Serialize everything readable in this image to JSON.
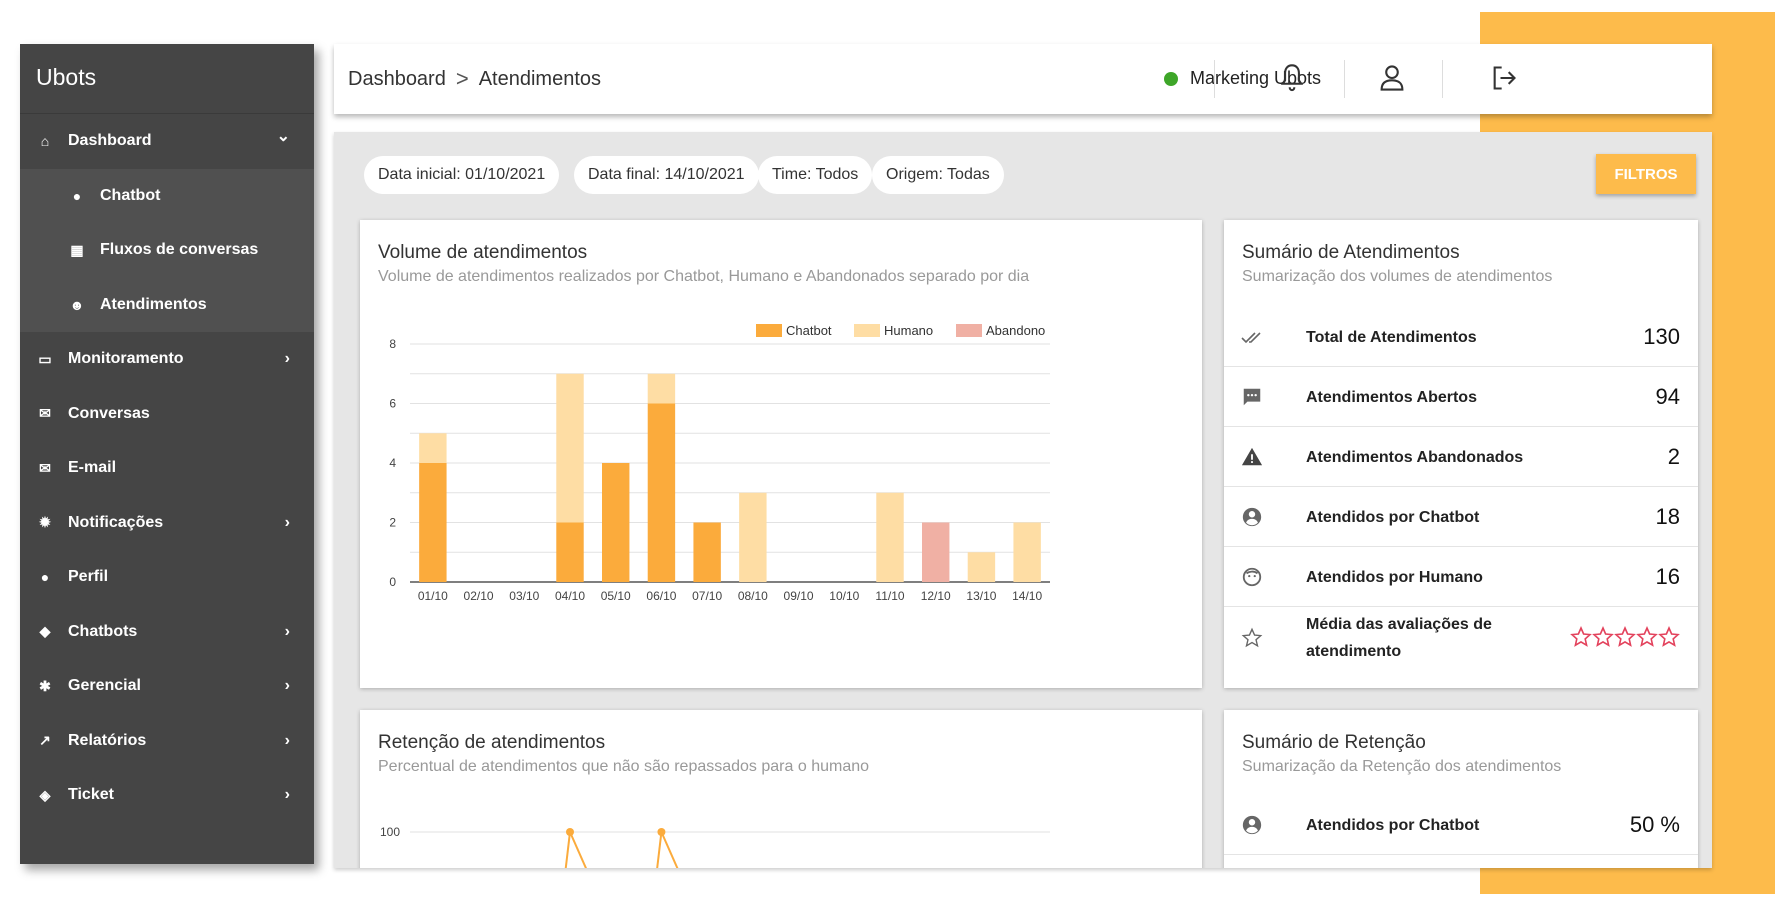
{
  "sidebar": {
    "brand": "Ubots",
    "items": [
      {
        "label": "Dashboard",
        "icon": "home-icon",
        "chevron": "⌄"
      },
      {
        "label": "Chatbot",
        "icon": "person-icon"
      },
      {
        "label": "Fluxos de conversas",
        "icon": "grid-icon"
      },
      {
        "label": "Atendimentos",
        "icon": "group-icon"
      },
      {
        "label": "Monitoramento",
        "icon": "monitor-icon",
        "chevron": "›"
      },
      {
        "label": "Conversas",
        "icon": "chat-icon"
      },
      {
        "label": "E-mail",
        "icon": "mail-icon"
      },
      {
        "label": "Notificações",
        "icon": "alert-icon",
        "chevron": "›"
      },
      {
        "label": "Perfil",
        "icon": "user-icon"
      },
      {
        "label": "Chatbots",
        "icon": "android-icon",
        "chevron": "›"
      },
      {
        "label": "Gerencial",
        "icon": "gear-icon",
        "chevron": "›"
      },
      {
        "label": "Relatórios",
        "icon": "chart-icon",
        "chevron": "›"
      },
      {
        "label": "Ticket",
        "icon": "ticket-icon",
        "chevron": "›"
      }
    ]
  },
  "header": {
    "breadcrumb": [
      "Dashboard",
      "Atendimentos"
    ],
    "separator": ">",
    "status_label": "Marketing Ubots",
    "status_color": "#3ea629"
  },
  "filters": {
    "chips": [
      "Data inicial: 01/10/2021",
      "Data final: 14/10/2021",
      "Time: Todos",
      "Origem: Todas"
    ],
    "button_label": "FILTROS"
  },
  "volume_card": {
    "title": "Volume de atendimentos",
    "subtitle": "Volume de atendimentos realizados por Chatbot, Humano e Abandonados separado por dia"
  },
  "summary_card": {
    "title": "Sumário de Atendimentos",
    "subtitle": "Sumarização dos volumes de atendimentos",
    "rows": [
      {
        "label": "Total de Atendimentos",
        "value": "130",
        "icon": "double-check-icon"
      },
      {
        "label": "Atendimentos Abertos",
        "value": "94",
        "icon": "message-icon"
      },
      {
        "label": "Atendimentos Abandonados",
        "value": "2",
        "icon": "warning-icon"
      },
      {
        "label": "Atendidos por Chatbot",
        "value": "18",
        "icon": "account-circle-icon"
      },
      {
        "label": "Atendidos por Humano",
        "value": "16",
        "icon": "face-icon"
      }
    ],
    "rating": {
      "label": "Média das avaliações de atendimento",
      "icon": "star-outline-icon",
      "stars_filled": 0,
      "stars_total": 5
    }
  },
  "retention_card": {
    "title": "Retenção de atendimentos",
    "subtitle": "Percentual de atendimentos que não são repassados para o humano"
  },
  "retention_summary": {
    "title": "Sumário de Retenção",
    "subtitle": "Sumarização da Retenção dos atendimentos",
    "rows": [
      {
        "label": "Atendidos por Chatbot",
        "value": "50 %",
        "icon": "account-circle-icon"
      }
    ]
  },
  "chart_data": [
    {
      "type": "bar",
      "stacked": true,
      "categories": [
        "01/10",
        "02/10",
        "03/10",
        "04/10",
        "05/10",
        "06/10",
        "07/10",
        "08/10",
        "09/10",
        "10/10",
        "11/10",
        "12/10",
        "13/10",
        "14/10"
      ],
      "series": [
        {
          "name": "Chatbot",
          "color": "#fbab3c",
          "values": [
            4,
            0,
            0,
            2,
            4,
            6,
            2,
            0,
            0,
            0,
            0,
            0,
            0,
            0
          ]
        },
        {
          "name": "Humano",
          "color": "#fedda4",
          "values": [
            1,
            0,
            0,
            5,
            0,
            1,
            0,
            3,
            0,
            0,
            3,
            0,
            1,
            2
          ]
        },
        {
          "name": "Abandono",
          "color": "#f0b0a4",
          "values": [
            0,
            0,
            0,
            0,
            0,
            0,
            0,
            0,
            0,
            0,
            0,
            2,
            0,
            0
          ]
        }
      ],
      "yticks": [
        0,
        2,
        4,
        6,
        8
      ],
      "ylim": [
        0,
        8
      ],
      "legend": "top-right",
      "grid": true
    },
    {
      "type": "line",
      "yticks": [
        100
      ],
      "ylim": [
        0,
        100
      ],
      "grid": true,
      "series": [
        {
          "color": "#fbab3c",
          "points": [
            {
              "x": "04/10",
              "y": 100
            },
            {
              "x": "06/10",
              "y": 100
            }
          ]
        }
      ]
    }
  ],
  "colors": {
    "accent": "#fdbb4b",
    "sidebar": "#454545",
    "content_bg": "#e6e6e6",
    "star": "#e3425c"
  }
}
